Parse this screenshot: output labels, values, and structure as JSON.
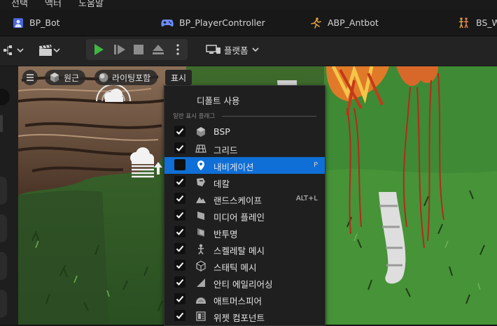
{
  "menubar": {
    "items": [
      "선택",
      "액터",
      "도움말"
    ]
  },
  "tabs": [
    {
      "label": "BP_Bot",
      "icon": "person-blueprint-icon",
      "color": "#6d8cff"
    },
    {
      "label": "BP_PlayerController",
      "icon": "gamepad-icon",
      "color": "#6d8cff"
    },
    {
      "label": "ABP_Antbot",
      "icon": "animation-figure-icon",
      "color": "#e0a040"
    },
    {
      "label": "BS_W",
      "icon": "blendspace-figures-icon",
      "color": "#e0a040"
    }
  ],
  "toolbar": {
    "platforms_label": "플랫폼"
  },
  "viewport": {
    "menu_icon": "hamburger-icon",
    "perspective_label": "원근",
    "lighting_label": "라이팅포함",
    "show_label": "표시"
  },
  "dropdown": {
    "default_label": "디폴트 사용",
    "section_label": "일반 표시 플래그",
    "items": [
      {
        "label": "BSP",
        "checked": true,
        "icon": "cube-icon",
        "shortcut": ""
      },
      {
        "label": "그리드",
        "checked": true,
        "icon": "grid-icon",
        "shortcut": ""
      },
      {
        "label": "내비게이션",
        "checked": false,
        "icon": "location-pin-icon",
        "shortcut": "P",
        "selected": true
      },
      {
        "label": "데칼",
        "checked": true,
        "icon": "decal-icon",
        "shortcut": ""
      },
      {
        "label": "랜드스케이프",
        "checked": true,
        "icon": "mountain-icon",
        "shortcut": "ALT+L"
      },
      {
        "label": "미디어 플레인",
        "checked": true,
        "icon": "media-plane-icon",
        "shortcut": ""
      },
      {
        "label": "반투명",
        "checked": true,
        "icon": "translucency-icon",
        "shortcut": ""
      },
      {
        "label": "스켈레탈 메시",
        "checked": true,
        "icon": "skeleton-icon",
        "shortcut": ""
      },
      {
        "label": "스태틱 메시",
        "checked": true,
        "icon": "static-mesh-icon",
        "shortcut": ""
      },
      {
        "label": "안티 에일리어싱",
        "checked": true,
        "icon": "antialiasing-icon",
        "shortcut": ""
      },
      {
        "label": "애트머스피어",
        "checked": true,
        "icon": "atmosphere-icon",
        "shortcut": ""
      },
      {
        "label": "위젯 컴포넌트",
        "checked": true,
        "icon": "widget-icon",
        "shortcut": ""
      }
    ]
  },
  "colors": {
    "accent": "#0f6fd6",
    "play_green": "#3fb83f",
    "menu_bg": "#1f1f1f"
  }
}
